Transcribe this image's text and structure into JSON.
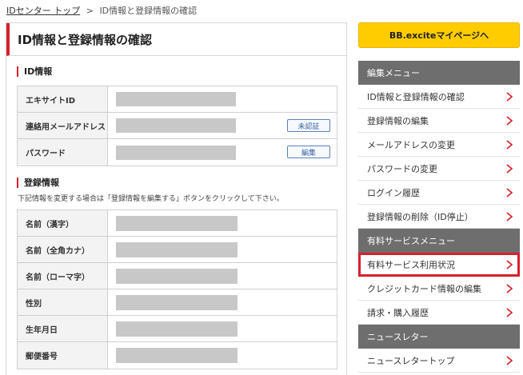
{
  "breadcrumb": {
    "home": "IDセンター トップ",
    "separator": ">",
    "current": "ID情報と登録情報の確認"
  },
  "page_title": "ID情報と登録情報の確認",
  "id_section": {
    "title": "ID情報",
    "rows": [
      {
        "label": "エキサイトID",
        "button": ""
      },
      {
        "label": "連絡用メールアドレス",
        "button": "未認証"
      },
      {
        "label": "パスワード",
        "button": "編集"
      }
    ]
  },
  "reg_section": {
    "title": "登録情報",
    "note": "下記情報を変更する場合は「登録情報を編集する」ボタンをクリックして下さい。",
    "rows": [
      {
        "label": "名前（漢字）"
      },
      {
        "label": "名前（全角カナ）"
      },
      {
        "label": "名前（ローマ字）"
      },
      {
        "label": "性別"
      },
      {
        "label": "生年月日"
      },
      {
        "label": "郵便番号"
      }
    ]
  },
  "sidebar": {
    "mypage_button": "BB.exciteマイページへ",
    "edit_menu": {
      "header": "編集メニュー",
      "items": [
        "ID情報と登録情報の確認",
        "登録情報の編集",
        "メールアドレスの変更",
        "パスワードの変更",
        "ログイン履歴",
        "登録情報の削除（ID停止）"
      ]
    },
    "paid_menu": {
      "header": "有料サービスメニュー",
      "items": [
        "有料サービス利用状況",
        "クレジットカード情報の編集",
        "請求・購入履歴"
      ]
    },
    "newsletter_menu": {
      "header": "ニュースレター",
      "items": [
        "ニュースレタートップ"
      ]
    }
  },
  "colors": {
    "accent_red": "#d7202b",
    "mypage_yellow": "#ffcc00",
    "menu_header_gray": "#6e6e6e"
  }
}
